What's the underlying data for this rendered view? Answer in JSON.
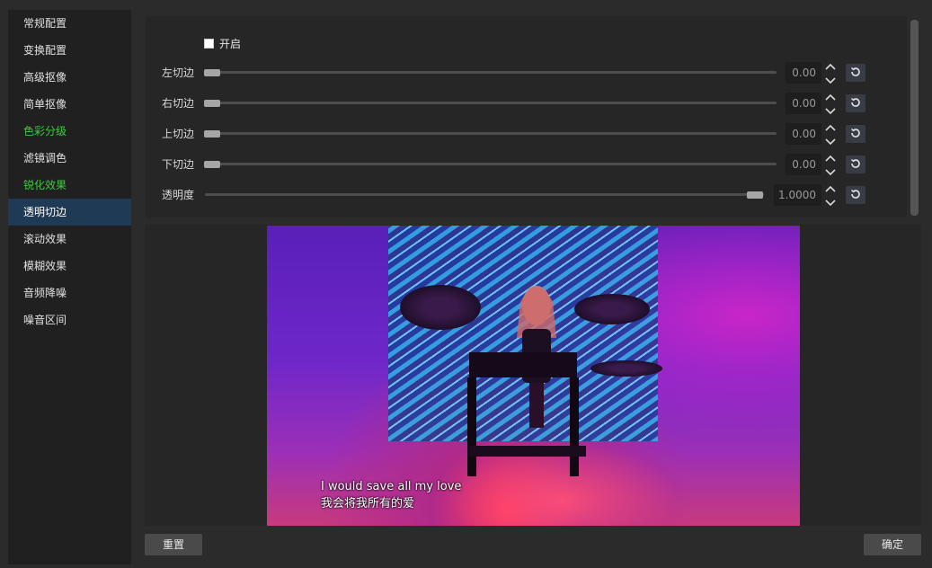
{
  "sidebar": {
    "items": [
      {
        "label": "常规配置",
        "state": "normal"
      },
      {
        "label": "变换配置",
        "state": "normal"
      },
      {
        "label": "高级抠像",
        "state": "normal"
      },
      {
        "label": "简单抠像",
        "state": "normal"
      },
      {
        "label": "色彩分级",
        "state": "highlight"
      },
      {
        "label": "滤镜调色",
        "state": "normal"
      },
      {
        "label": "锐化效果",
        "state": "highlight"
      },
      {
        "label": "透明切边",
        "state": "active"
      },
      {
        "label": "滚动效果",
        "state": "normal"
      },
      {
        "label": "模糊效果",
        "state": "normal"
      },
      {
        "label": "音频降噪",
        "state": "normal"
      },
      {
        "label": "噪音区间",
        "state": "normal"
      }
    ],
    "highlight_color": "#3fc93f",
    "active_bg": "#1e3a54"
  },
  "settings": {
    "enable": {
      "label": "开启",
      "checked": false
    },
    "rows": [
      {
        "label": "左切边",
        "value": "0.00",
        "slider": 0.0
      },
      {
        "label": "右切边",
        "value": "0.00",
        "slider": 0.0
      },
      {
        "label": "上切边",
        "value": "0.00",
        "slider": 0.0
      },
      {
        "label": "下切边",
        "value": "0.00",
        "slider": 0.0
      },
      {
        "label": "透明度",
        "value": "1.0000",
        "slider": 1.0
      }
    ],
    "reset_icon": "reset-icon",
    "spin_icon": "spin-arrows-icon"
  },
  "preview": {
    "subtitle_en": "I would save all my love",
    "subtitle_zh": "我会将我所有的爱"
  },
  "footer": {
    "reset_label": "重置",
    "ok_label": "确定"
  }
}
